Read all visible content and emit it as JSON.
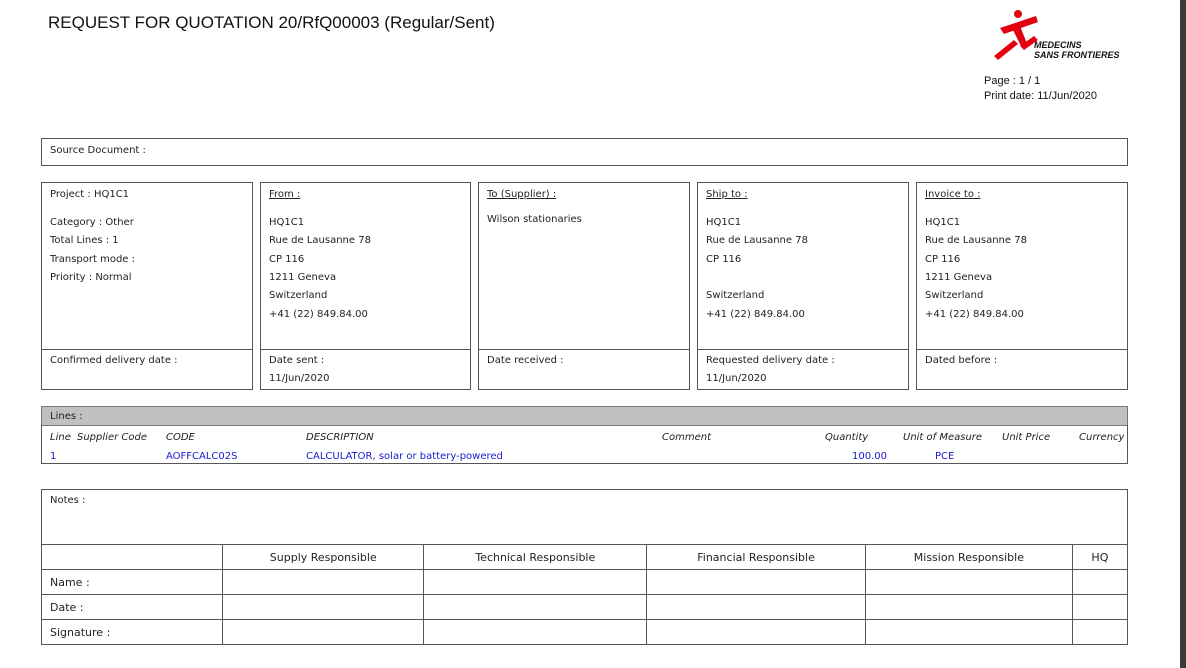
{
  "title": "REQUEST FOR QUOTATION 20/RfQ00003 (Regular/Sent)",
  "logo": {
    "line1": "MEDECINS",
    "line2": "SANS FRONTIERES",
    "color": "#e3000f"
  },
  "page": "Page : 1  / 1",
  "print_date": "Print date: 11/Jun/2020",
  "source_document": "Source Document :",
  "project": {
    "project": "Project : HQ1C1",
    "category": "Category : Other",
    "total_lines": "Total Lines : 1",
    "transport": "Transport mode :",
    "priority": "Priority : Normal",
    "footer": "Confirmed delivery date :"
  },
  "from": {
    "label": "From :",
    "lines": [
      "HQ1C1",
      "Rue de Lausanne 78",
      "CP 116",
      "1211 Geneva",
      "Switzerland",
      "+41 (22) 849.84.00"
    ],
    "footer": "Date sent :",
    "footer_value": "11/Jun/2020"
  },
  "to": {
    "label": "To (Supplier) :",
    "lines": [
      "Wilson stationaries"
    ],
    "footer": "Date received :"
  },
  "ship": {
    "label": "Ship to :",
    "lines": [
      "HQ1C1",
      "Rue de Lausanne 78",
      "CP 116",
      "",
      "Switzerland",
      "+41 (22) 849.84.00"
    ],
    "footer": "Requested delivery date :",
    "footer_value": "11/Jun/2020"
  },
  "invoice": {
    "label": "Invoice to :",
    "lines": [
      "HQ1C1",
      "Rue de Lausanne 78",
      "CP 116",
      "1211 Geneva",
      "Switzerland",
      "+41 (22) 849.84.00"
    ],
    "footer": "Dated before :"
  },
  "lines": {
    "label": "Lines :",
    "headers": [
      "Line",
      "Supplier Code",
      "CODE",
      "DESCRIPTION",
      "Comment",
      "Quantity",
      "Unit of Measure",
      "Unit Price",
      "Currency"
    ],
    "rows": [
      {
        "line": "1",
        "code": "AOFFCALC02S",
        "description": "CALCULATOR, solar or battery-powered",
        "quantity": "100.00",
        "uom": "PCE"
      }
    ]
  },
  "notes": "Notes :",
  "signatures": {
    "columns": [
      "Supply Responsible",
      "Technical Responsible",
      "Financial Responsible",
      "Mission Responsible",
      "HQ"
    ],
    "rows": [
      "Name :",
      "Date :",
      "Signature :"
    ]
  }
}
